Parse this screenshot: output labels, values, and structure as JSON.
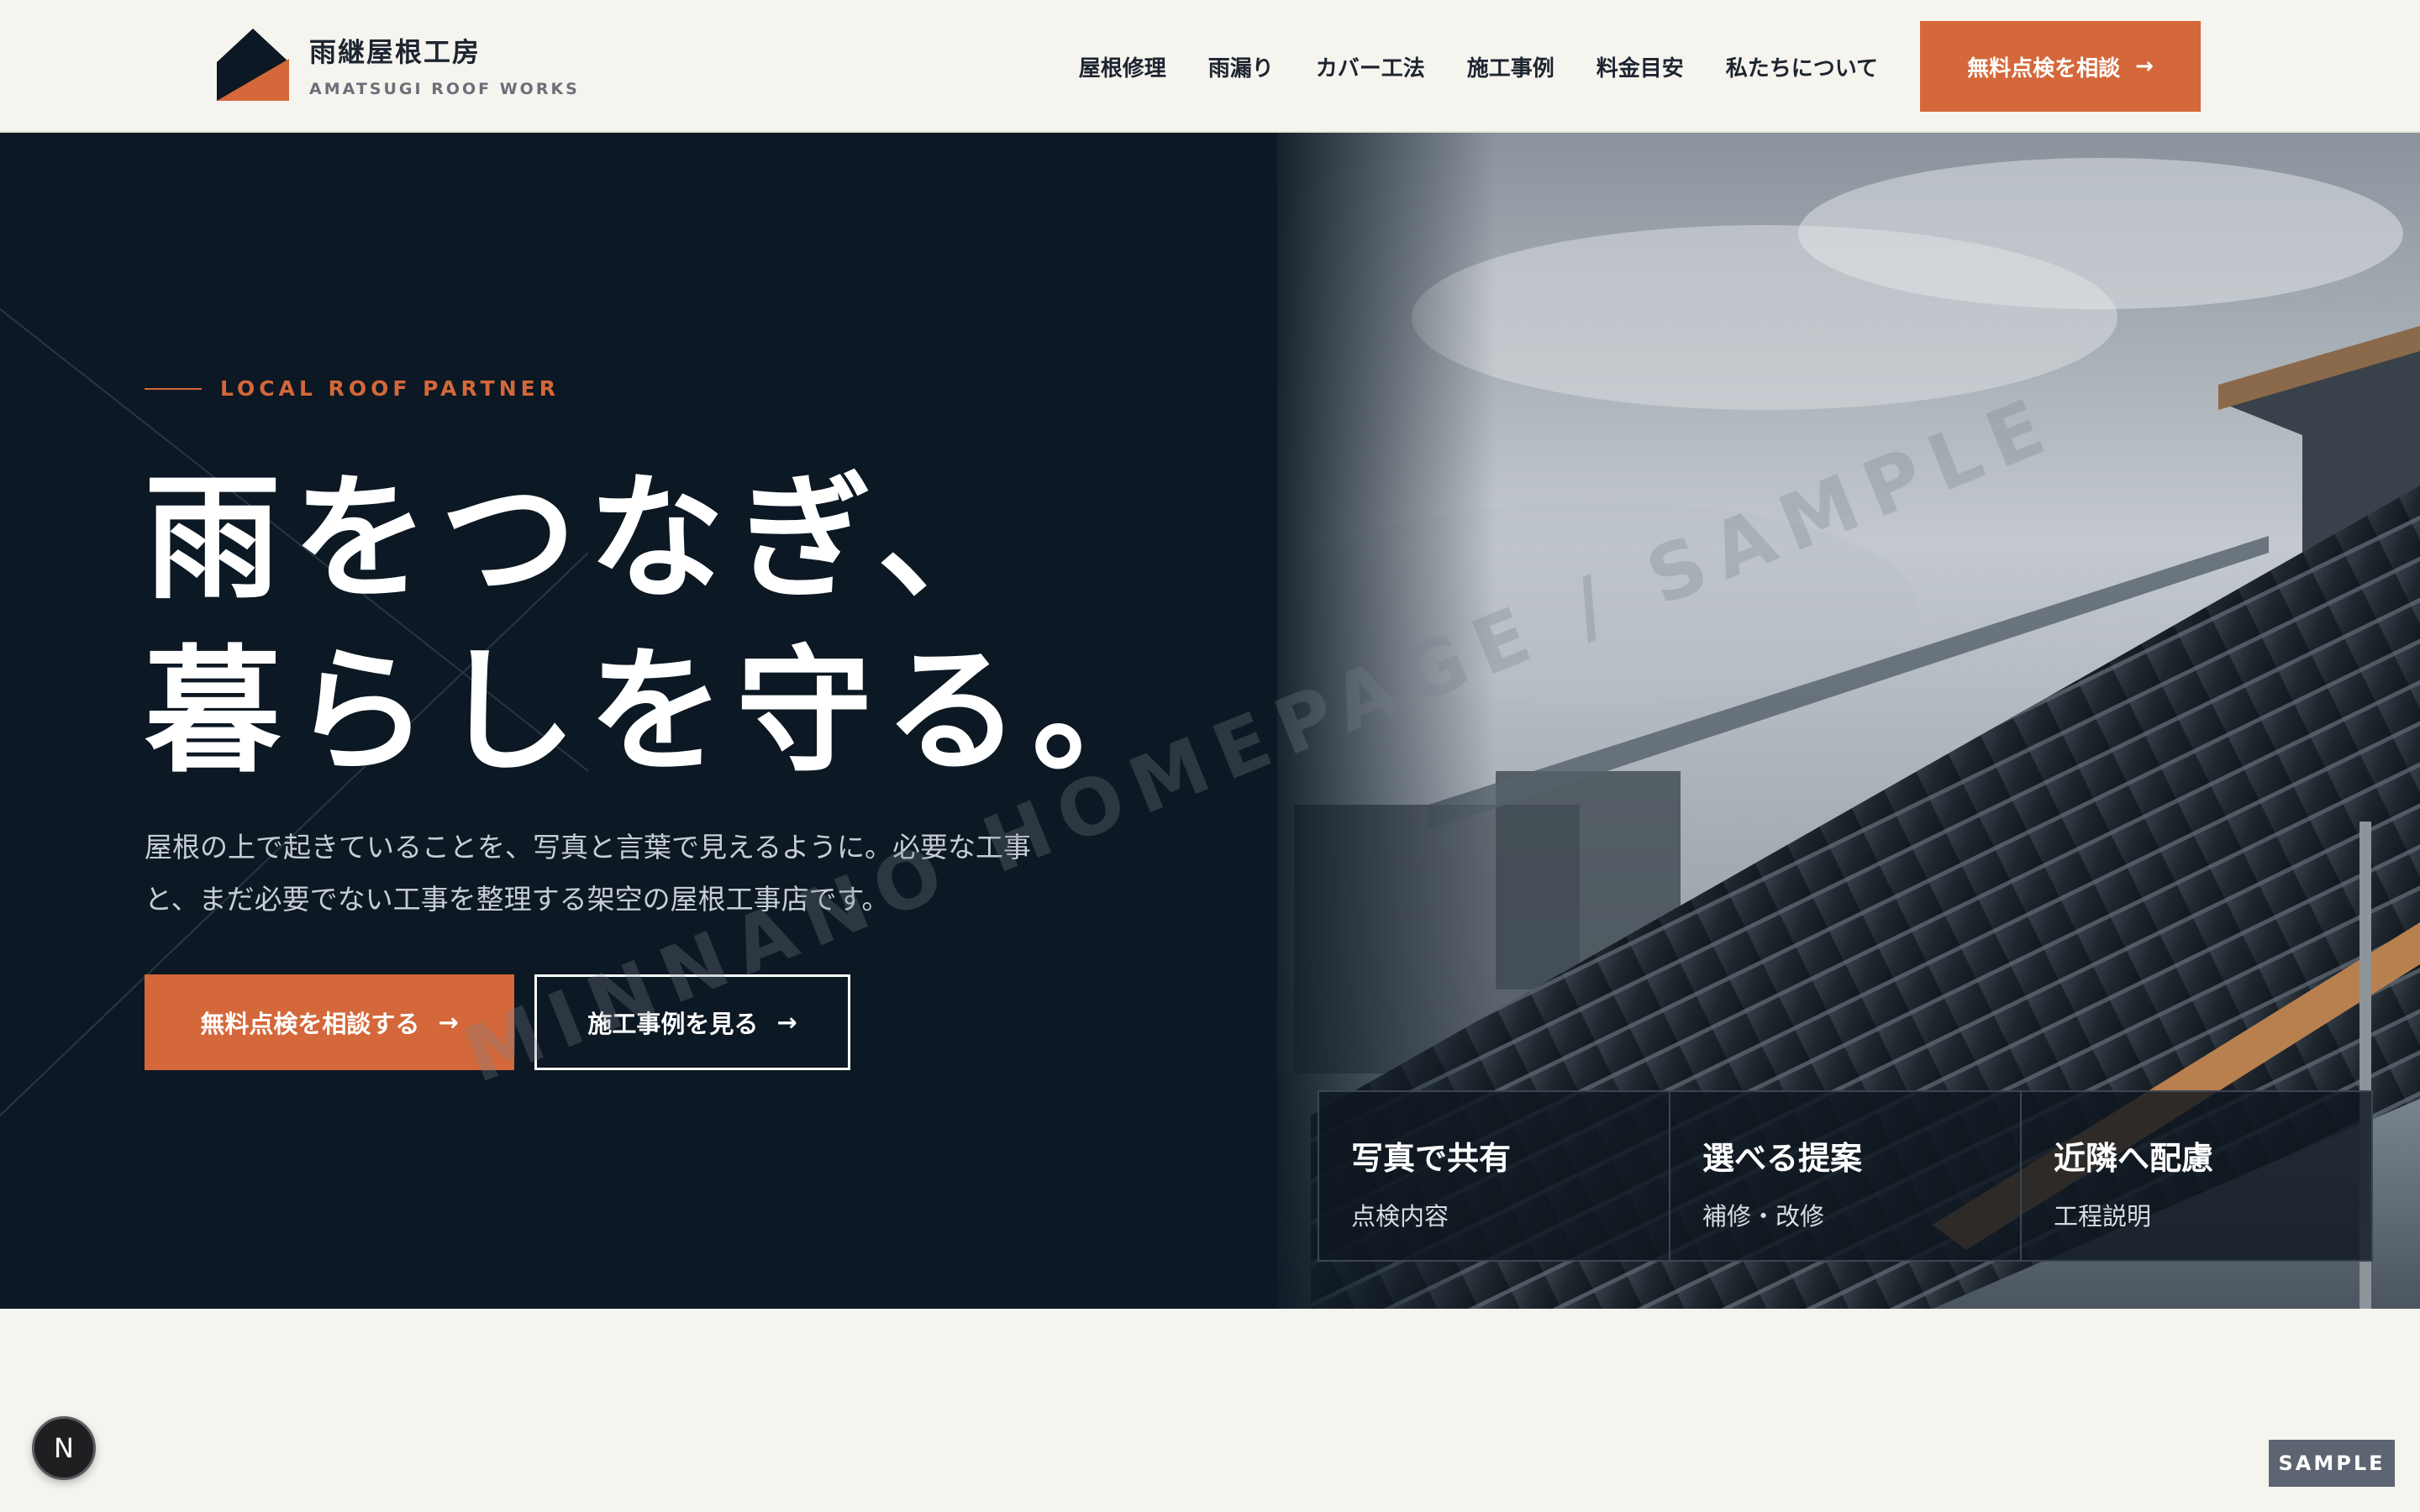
{
  "brand": {
    "name_jp": "雨継屋根工房",
    "name_en": "AMATSUGI ROOF WORKS",
    "accent_color": "#d4683a",
    "dark_color": "#0c1823"
  },
  "nav": {
    "items": [
      {
        "label": "屋根修理"
      },
      {
        "label": "雨漏り"
      },
      {
        "label": "カバー工法"
      },
      {
        "label": "施工事例"
      },
      {
        "label": "料金目安"
      },
      {
        "label": "私たちについて"
      }
    ],
    "cta_label": "無料点検を相談",
    "cta_arrow": "→"
  },
  "hero": {
    "eyebrow": "LOCAL ROOF PARTNER",
    "headline_line1": "雨をつなぎ、",
    "headline_line2": "暮らしを守る。",
    "lead_line1": "屋根の上で起きていることを、写真と言葉で見えるように。必要な工事",
    "lead_line2": "と、まだ必要でない工事を整理する架空の屋根工事店です。",
    "primary_button": "無料点検を相談する",
    "secondary_button": "施工事例を見る",
    "button_arrow": "→",
    "image_description": "rain-wet dark metal standing-seam roof under cloudy sky"
  },
  "features": [
    {
      "title": "写真で共有",
      "sub": "点検内容"
    },
    {
      "title": "選べる提案",
      "sub": "補修・改修"
    },
    {
      "title": "近隣へ配慮",
      "sub": "工程説明"
    }
  ],
  "watermark": "MINNANO HOMEPAGE / SAMPLE",
  "fab_label": "N",
  "sample_badge": "SAMPLE"
}
